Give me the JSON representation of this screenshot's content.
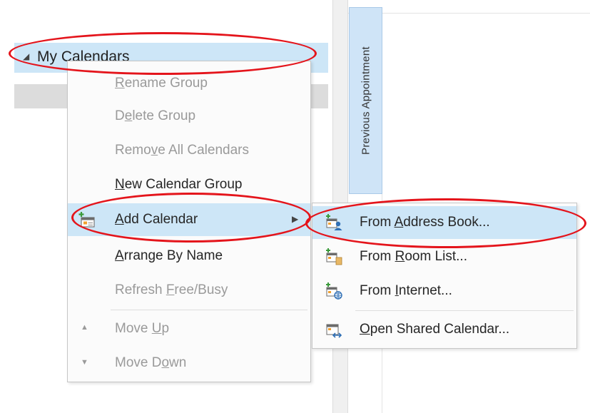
{
  "group": {
    "label": "My Calendars",
    "arrow_icon": "collapse-triangle-icon"
  },
  "prev_appointment": "Previous Appointment",
  "context_menu": {
    "rename_group": [
      "",
      "R",
      "ename Group"
    ],
    "delete_group": [
      "D",
      "e",
      "lete Group"
    ],
    "remove_all": [
      "Remo",
      "v",
      "e All Calendars"
    ],
    "new_group": [
      "",
      "N",
      "ew Calendar Group"
    ],
    "add_calendar": [
      "",
      "A",
      "dd Calendar"
    ],
    "arrange_by_name": [
      "",
      "A",
      "rrange By Name"
    ],
    "refresh": [
      "Refresh ",
      "F",
      "ree/Busy"
    ],
    "move_up": [
      "Move ",
      "U",
      "p"
    ],
    "move_down": [
      "Move D",
      "o",
      "wn"
    ]
  },
  "submenu": {
    "from_address_book": [
      "From ",
      "A",
      "ddress Book..."
    ],
    "from_room_list": [
      "From ",
      "R",
      "oom List..."
    ],
    "from_internet": [
      "From ",
      "I",
      "nternet..."
    ],
    "open_shared": [
      "",
      "O",
      "pen Shared Calendar..."
    ]
  },
  "colors": {
    "highlight": "#cde6f7",
    "annotation": "#e4141b",
    "disabled_text": "#9a9a9a"
  }
}
